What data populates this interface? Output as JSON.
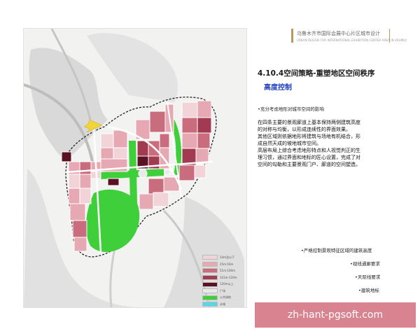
{
  "header": {
    "title": "乌鲁木齐市国际会展中心片区城市设计",
    "subtitle": "URBAN DESIGN FOR INTERNATIONAL EXHIBITION CENTER AREA IN URUMQI"
  },
  "section": {
    "title": "4.10.4空间策略-重塑地区空间秩序",
    "subtitle": "高度控制"
  },
  "intro_bullet": "•充分考虑地形对城市空间的影响",
  "paragraphs": [
    "在四条主要的景观廊道上基本保持两侧建筑高度",
    "的对称与均衡，以形成连续性的界面效果。",
    "其他区域则依据地形将建筑与场地有机结合，形",
    "成自然天成的坡地城市空间。",
    "高层布局上综合考虑地形特点和人视觉判正的生",
    "理习惯，通过界面和地标的匠心设置，完成了对",
    "空间的勾勒和主要景观门户、廊道的空间塑造。"
  ],
  "bottom_bullets": [
    "•严格控制景观特征区域的建筑高度",
    "•视线通廊要求",
    "•天际线要求",
    "•建筑地标"
  ],
  "legend": [
    {
      "label": "24m及以下",
      "color": "#f2d4d8"
    },
    {
      "label": "25m-50m",
      "color": "#e6a9b3"
    },
    {
      "label": "51m-100m",
      "color": "#c96c7d"
    },
    {
      "label": "101m-120m",
      "color": "#a23a52"
    },
    {
      "label": "120m以上",
      "color": "#5a1124"
    },
    {
      "label": "广场",
      "color": "#e9e9e9"
    },
    {
      "label": "公共绿地",
      "color": "#3fcf3a"
    },
    {
      "label": "水域",
      "color": "#59d6e8"
    }
  ],
  "colors": {
    "low": "#f2d4d8",
    "mid": "#e6a9b3",
    "high": "#c96c7d",
    "higher": "#a23a52",
    "tallest": "#5a1124",
    "green": "#3fcf3a",
    "road": "#ffffff",
    "terrain": "#cfcfcf",
    "accent": "#1f3fbf",
    "watermark": "#d8838f"
  },
  "watermark": "zh-hant-pgsoft.com"
}
